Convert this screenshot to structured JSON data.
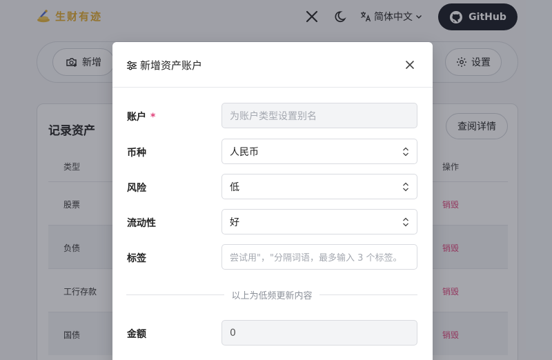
{
  "app": {
    "logo_text": "生财有迹",
    "language": "简体中文",
    "github_label": "GitHub"
  },
  "toolbar": {
    "add_label": "新增",
    "settings_label": "设置"
  },
  "card": {
    "title": "记录资产",
    "detail_button": "查阅详情",
    "columns": [
      "类型",
      "操作"
    ],
    "rows": [
      {
        "type": "股票",
        "action": "销毁"
      },
      {
        "type": "负债",
        "action": "销毁"
      },
      {
        "type": "工行存款",
        "action": "销毁"
      },
      {
        "type": "国债",
        "action": "销毁"
      }
    ]
  },
  "modal": {
    "title": "新增资产账户",
    "fields": {
      "account_label": "账户",
      "required_mark": "*",
      "account_placeholder": "为账户类型设置别名",
      "currency_label": "币种",
      "currency_value": "人民币",
      "risk_label": "风险",
      "risk_value": "低",
      "liquidity_label": "流动性",
      "liquidity_value": "好",
      "tags_label": "标签",
      "tags_placeholder": "尝试用\"，\"分隔词语，最多输入 3 个标签。",
      "divider_text": "以上为低频更新内容",
      "amount_label": "金额",
      "amount_value": "0"
    }
  },
  "colors": {
    "accent_gold": "#e0a92a",
    "danger": "#e0427a",
    "github_bg": "#14171f"
  }
}
